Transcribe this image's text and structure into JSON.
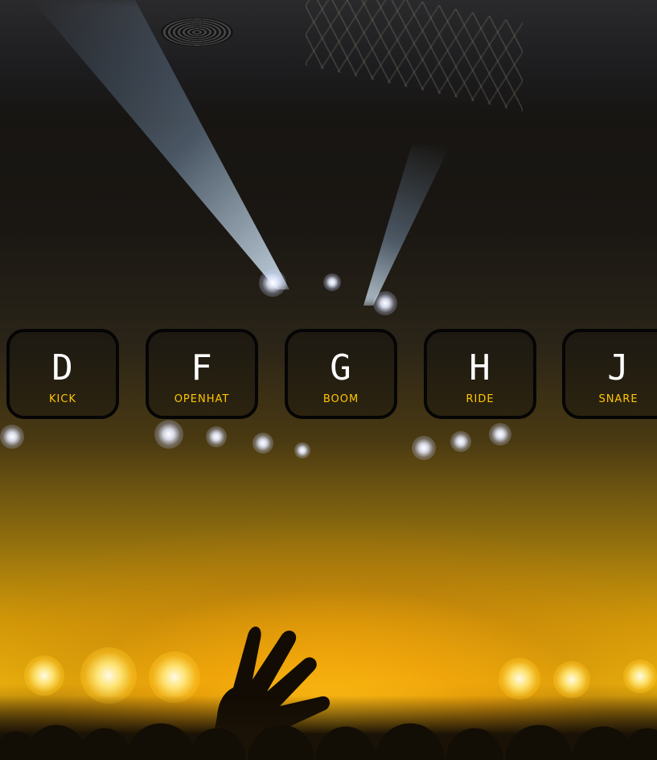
{
  "pads": [
    {
      "key": "D",
      "sound": "KICK"
    },
    {
      "key": "F",
      "sound": "OPENHAT"
    },
    {
      "key": "G",
      "sound": "BOOM"
    },
    {
      "key": "H",
      "sound": "RIDE"
    },
    {
      "key": "J",
      "sound": "SNARE"
    }
  ],
  "colors": {
    "key_text": "#ffffff",
    "sound_text": "#ffc600",
    "pad_border": "#050505"
  }
}
